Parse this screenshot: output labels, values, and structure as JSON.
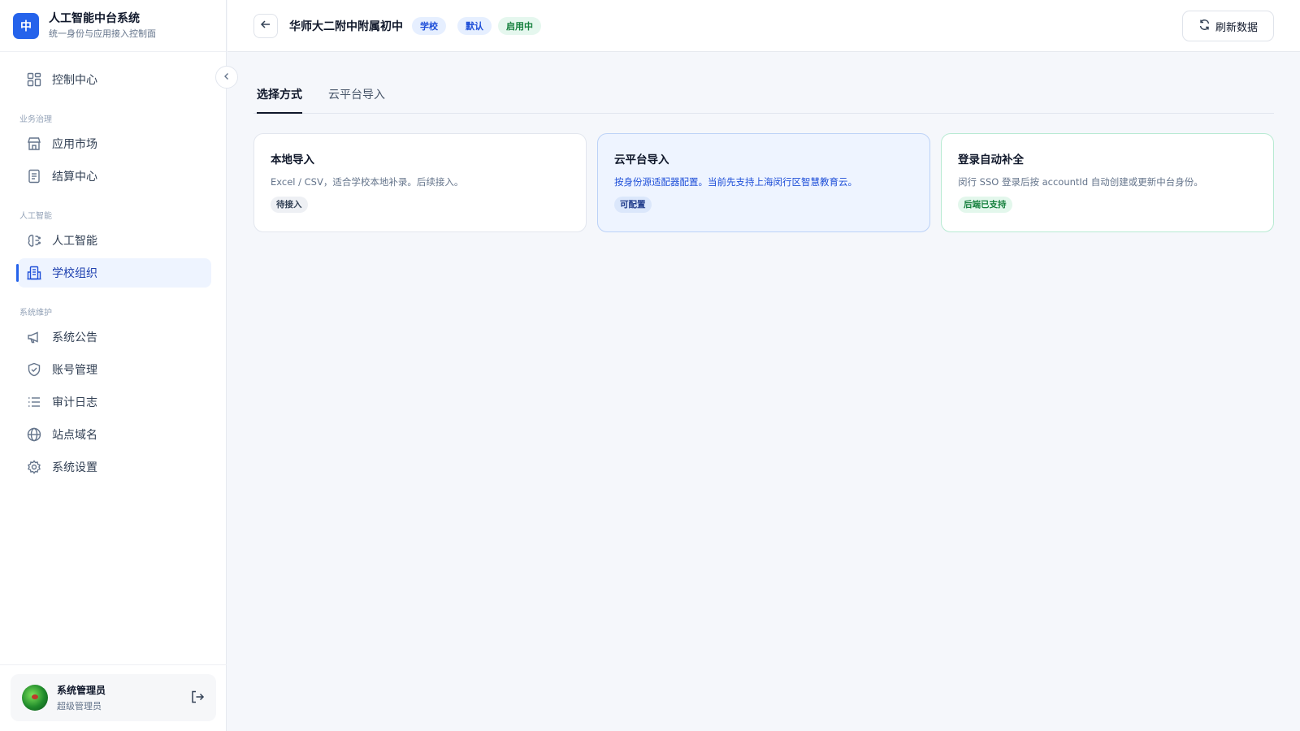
{
  "brand": {
    "logo_char": "中",
    "title": "人工智能中台系统",
    "subtitle": "统一身份与应用接入控制面"
  },
  "sidebar": {
    "items": [
      {
        "label": "控制中心",
        "icon": "dashboard-icon"
      },
      {
        "label": "应用市场",
        "icon": "store-icon"
      },
      {
        "label": "结算中心",
        "icon": "document-icon"
      },
      {
        "label": "人工智能",
        "icon": "brain-icon"
      },
      {
        "label": "学校组织",
        "icon": "building-icon",
        "active": true
      },
      {
        "label": "系统公告",
        "icon": "megaphone-icon"
      },
      {
        "label": "账号管理",
        "icon": "shield-icon"
      },
      {
        "label": "审计日志",
        "icon": "list-icon"
      },
      {
        "label": "站点域名",
        "icon": "globe-icon"
      },
      {
        "label": "系统设置",
        "icon": "gear-icon"
      }
    ],
    "groups": [
      "业务治理",
      "人工智能",
      "系统维护"
    ]
  },
  "user": {
    "name": "系统管理员",
    "role": "超级管理员"
  },
  "header": {
    "title": "华师大二附中附属初中",
    "badges": [
      "学校",
      "默认",
      "启用中"
    ],
    "refresh_label": "刷新数据"
  },
  "tabs": [
    {
      "label": "选择方式",
      "active": true
    },
    {
      "label": "云平台导入",
      "active": false
    }
  ],
  "cards": [
    {
      "title": "本地导入",
      "desc": "Excel / CSV，适合学校本地补录。后续接入。",
      "tag": "待接入"
    },
    {
      "title": "云平台导入",
      "desc": "按身份源适配器配置。当前先支持上海闵行区智慧教育云。",
      "tag": "可配置"
    },
    {
      "title": "登录自动补全",
      "desc": "闵行 SSO 登录后按 accountId 自动创建或更新中台身份。",
      "tag": "后端已支持"
    }
  ],
  "colors": {
    "accent": "#2563eb",
    "active_bg": "#eef4ff",
    "success": "#15803d"
  }
}
